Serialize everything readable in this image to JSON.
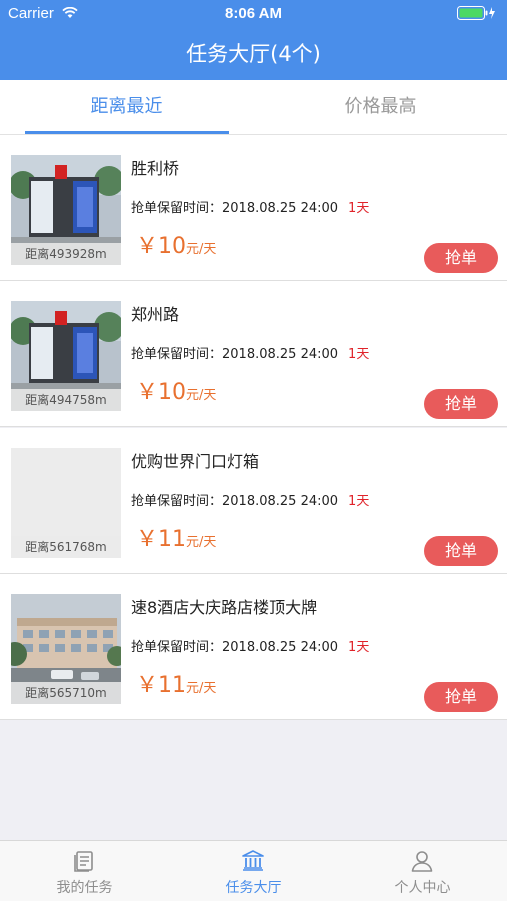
{
  "status_bar": {
    "carrier": "Carrier",
    "time": "8:06 AM"
  },
  "nav": {
    "title": "任务大厅(4个)"
  },
  "tabs": [
    {
      "label": "距离最近",
      "active": true
    },
    {
      "label": "价格最高",
      "active": false
    }
  ],
  "common": {
    "deadline_label": "抢单保留时间：",
    "grab_label": "抢单",
    "unit": "元/天"
  },
  "tasks": [
    {
      "title": "胜利桥",
      "deadline": "2018.08.25 24:00",
      "days": "1天",
      "price": "￥10",
      "distance": "距离493928m",
      "image": "bus-stop-billboard"
    },
    {
      "title": "郑州路",
      "deadline": "2018.08.25 24:00",
      "days": "1天",
      "price": "￥10",
      "distance": "距离494758m",
      "image": "bus-stop-billboard"
    },
    {
      "title": "优购世界门口灯箱",
      "deadline": "2018.08.25 24:00",
      "days": "1天",
      "price": "￥11",
      "distance": "距离561768m",
      "image": "placeholder"
    },
    {
      "title": "速8酒店大庆路店楼顶大牌",
      "deadline": "2018.08.25 24:00",
      "days": "1天",
      "price": "￥11",
      "distance": "距离565710m",
      "image": "building-photo"
    }
  ],
  "tabbar": [
    {
      "label": "我的任务",
      "icon": "document-icon",
      "active": false
    },
    {
      "label": "任务大厅",
      "icon": "bank-icon",
      "active": true
    },
    {
      "label": "个人中心",
      "icon": "person-icon",
      "active": false
    }
  ],
  "colors": {
    "primary": "#4a8eea",
    "price": "#e8702f",
    "grab": "#e85b5b",
    "days": "#e0232a"
  }
}
